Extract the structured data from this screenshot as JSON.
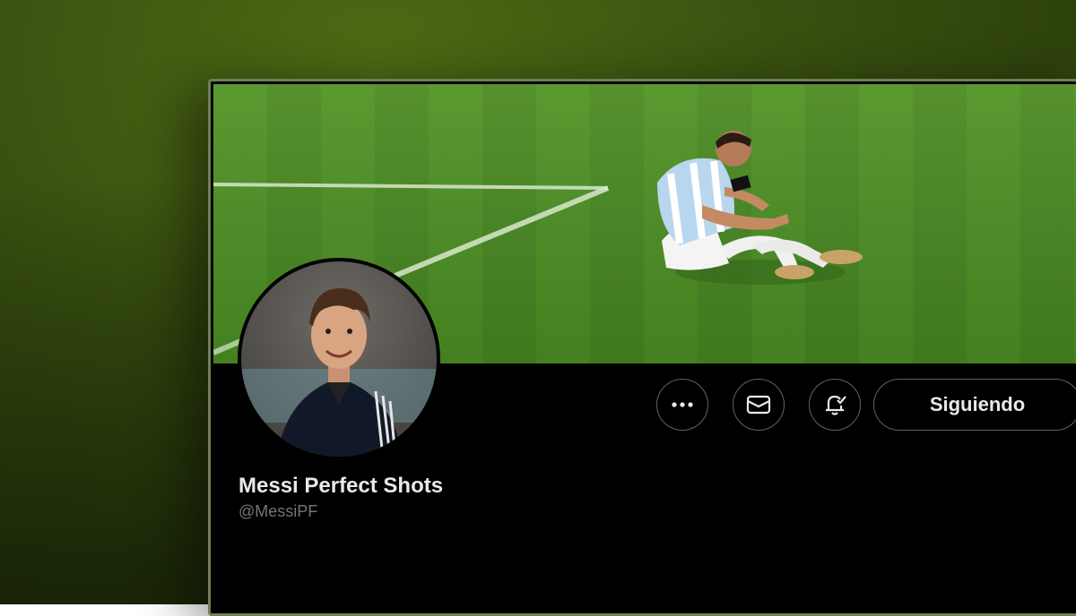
{
  "profile": {
    "display_name": "Messi Perfect Shots",
    "handle": "@MessiPF"
  },
  "actions": {
    "more_icon": "more-dots-icon",
    "message_icon": "envelope-icon",
    "notify_icon": "bell-check-icon",
    "follow_label": "Siguiendo"
  },
  "colors": {
    "page_bg": "#000000",
    "text_primary": "#e7e9ea",
    "text_secondary": "#71767b",
    "button_border": "#5b646c"
  }
}
